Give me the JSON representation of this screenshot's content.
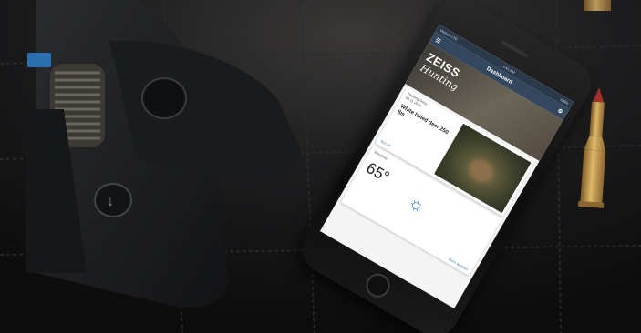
{
  "scene": {
    "colors": {
      "leather": "#151516",
      "stitch": "#2c2c2e",
      "binocular": "#1c1d1f",
      "brass": "#c59a4c",
      "tip": "#a8332b",
      "accent": "#2f75c0"
    }
  },
  "phone": {
    "status": {
      "carrier": "Verizon LTE",
      "time": "9:41 AM",
      "battery": "100%"
    },
    "appbar": {
      "title": "Dashboard",
      "menu_icon": "hamburger-icon",
      "action_icon": "gear-icon"
    },
    "hero": {
      "brand": "ZEISS",
      "subtitle": "Hunting"
    },
    "story_card": {
      "title": "Hunting Diary",
      "meta": "03.11.2016",
      "headline": "White tailed deer 250 lbs",
      "footer": "See all"
    },
    "weather_card": {
      "title": "Weather",
      "temperature": "65°",
      "icon": "sun-icon",
      "footer": "More weather"
    }
  }
}
